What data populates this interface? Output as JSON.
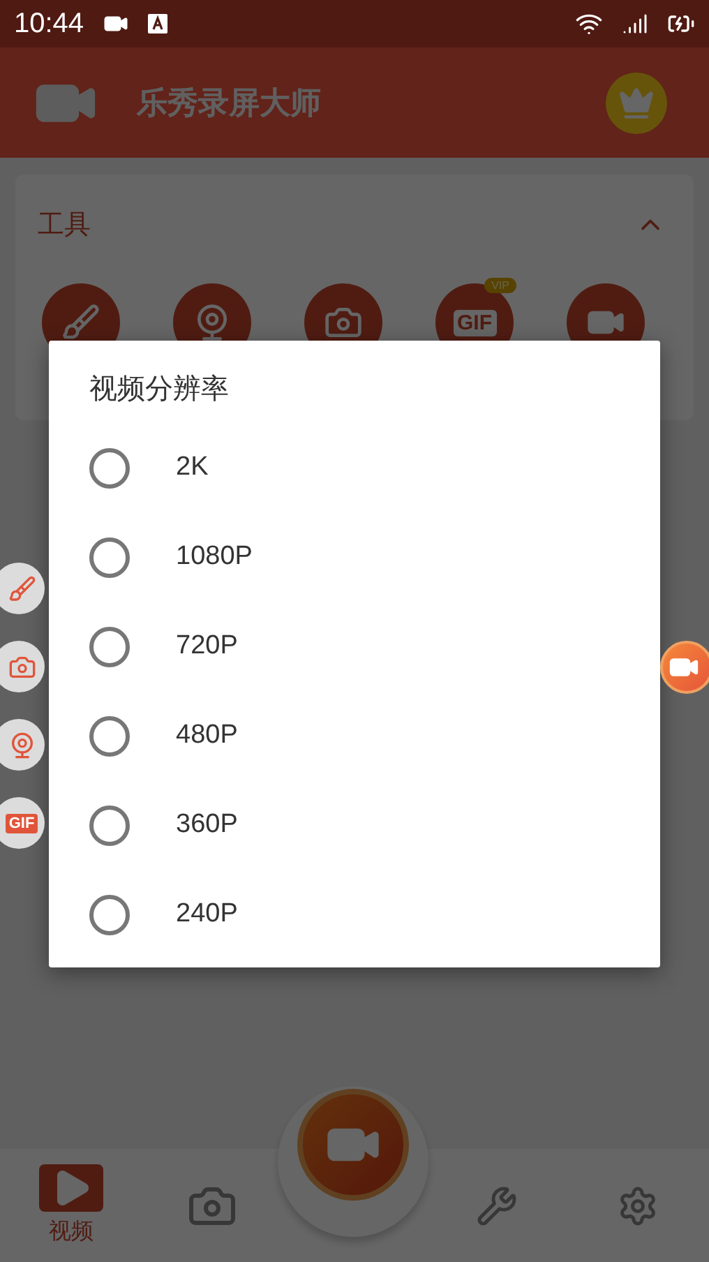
{
  "status_bar": {
    "time": "10:44"
  },
  "app_bar": {
    "title": "乐秀录屏大师"
  },
  "tools_card": {
    "title": "工具",
    "expanded": true,
    "tools": [
      {
        "kind": "brush"
      },
      {
        "kind": "webcam"
      },
      {
        "kind": "camera"
      },
      {
        "kind": "gif",
        "label": "GIF",
        "badge": "VIP"
      },
      {
        "kind": "video"
      }
    ]
  },
  "dialog": {
    "title": "视频分辨率",
    "options": [
      {
        "label": "2K",
        "selected": false
      },
      {
        "label": "1080P",
        "selected": false
      },
      {
        "label": "720P",
        "selected": false
      },
      {
        "label": "480P",
        "selected": false
      },
      {
        "label": "360P",
        "selected": false
      },
      {
        "label": "240P",
        "selected": false
      }
    ]
  },
  "floating_tools": [
    {
      "kind": "brush"
    },
    {
      "kind": "camera"
    },
    {
      "kind": "webcam"
    },
    {
      "kind": "gif",
      "label": "GIF"
    }
  ],
  "bottom_nav": {
    "items": [
      {
        "kind": "video",
        "label": "视频",
        "selected": true
      },
      {
        "kind": "camera",
        "selected": false
      },
      {
        "kind": "tools",
        "selected": false
      },
      {
        "kind": "settings",
        "selected": false
      }
    ]
  }
}
